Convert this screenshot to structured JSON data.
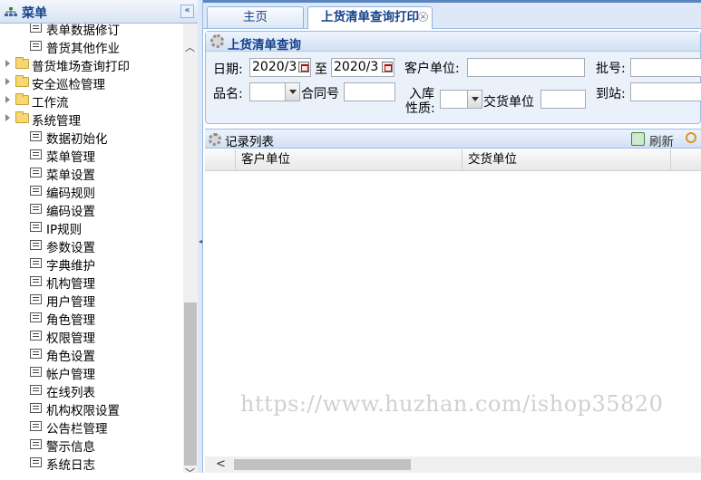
{
  "sidebar": {
    "title": "菜单",
    "collapse_symbol": "«",
    "items": [
      {
        "label": "表单数据修订",
        "type": "leaf",
        "icon": "page-icon"
      },
      {
        "label": "普货其他作业",
        "type": "leaf",
        "icon": "page-icon"
      },
      {
        "label": "普货堆场查询打印",
        "type": "folder",
        "icon": "folder-icon"
      },
      {
        "label": "安全巡检管理",
        "type": "folder",
        "icon": "folder-icon"
      },
      {
        "label": "工作流",
        "type": "folder",
        "icon": "folder-icon"
      },
      {
        "label": "系统管理",
        "type": "folder",
        "icon": "folder-icon"
      },
      {
        "label": "数据初始化",
        "type": "leaf",
        "icon": "page-icon"
      },
      {
        "label": "菜单管理",
        "type": "leaf",
        "icon": "page-icon"
      },
      {
        "label": "菜单设置",
        "type": "leaf",
        "icon": "page-icon"
      },
      {
        "label": "编码规则",
        "type": "leaf",
        "icon": "page-icon"
      },
      {
        "label": "编码设置",
        "type": "leaf",
        "icon": "page-icon"
      },
      {
        "label": "IP规则",
        "type": "leaf",
        "icon": "page-icon"
      },
      {
        "label": "参数设置",
        "type": "leaf",
        "icon": "page-icon"
      },
      {
        "label": "字典维护",
        "type": "leaf",
        "icon": "page-icon"
      },
      {
        "label": "机构管理",
        "type": "leaf",
        "icon": "page-icon"
      },
      {
        "label": "用户管理",
        "type": "leaf",
        "icon": "page-icon"
      },
      {
        "label": "角色管理",
        "type": "leaf",
        "icon": "page-icon"
      },
      {
        "label": "权限管理",
        "type": "leaf",
        "icon": "page-icon"
      },
      {
        "label": "角色设置",
        "type": "leaf",
        "icon": "page-icon"
      },
      {
        "label": "帐户管理",
        "type": "leaf",
        "icon": "page-icon"
      },
      {
        "label": "在线列表",
        "type": "leaf",
        "icon": "page-icon"
      },
      {
        "label": "机构权限设置",
        "type": "leaf",
        "icon": "page-icon"
      },
      {
        "label": "公告栏管理",
        "type": "leaf",
        "icon": "page-icon"
      },
      {
        "label": "警示信息",
        "type": "leaf",
        "icon": "page-icon"
      },
      {
        "label": "系统日志",
        "type": "leaf",
        "icon": "page-icon"
      }
    ]
  },
  "tabs": [
    {
      "label": "主页"
    },
    {
      "label": "上货清单查询打印",
      "active": true,
      "close_symbol": "×"
    }
  ],
  "query": {
    "title": "上货清单查询",
    "date_label": "日期:",
    "date_from": "2020/3",
    "date_to_label": "至",
    "date_to": "2020/3",
    "customer_label": "客户单位:",
    "customer_value": "",
    "batch_label": "批号:",
    "batch_value": "",
    "product_label": "品名:",
    "product_value": "",
    "contract_label": "合同号",
    "contract_value": "",
    "storage_label_1": "入库",
    "storage_label_2": "性质:",
    "storage_value": "",
    "delivery_label": "交货单位",
    "delivery_value": "",
    "destination_label": "到站:",
    "destination_value": ""
  },
  "records": {
    "title": "记录列表",
    "refresh_label": "刷新",
    "columns": [
      "客户单位",
      "交货单位"
    ]
  },
  "watermark": "https://www.huzhan.com/ishop35820",
  "colors": {
    "accent": "#15428b",
    "border": "#99bbe8",
    "panel": "#eaf1fb"
  }
}
